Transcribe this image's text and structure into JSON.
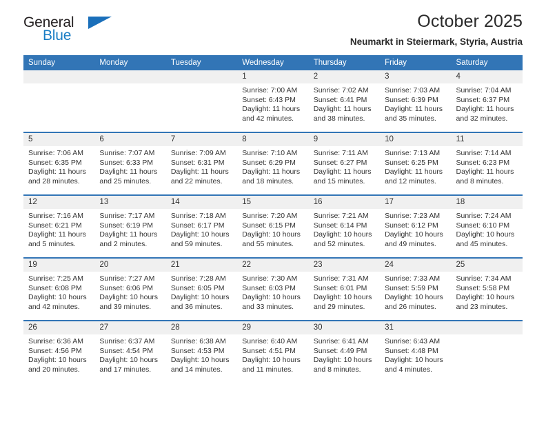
{
  "brand": {
    "name_top": "General",
    "name_bottom": "Blue",
    "triangle_color": "#1a6fba",
    "blue_text_color": "#1a7dc4"
  },
  "header": {
    "title": "October 2025",
    "subtitle": "Neumarkt in Steiermark, Styria, Austria"
  },
  "theme": {
    "header_bg": "#3275b6",
    "daynum_bg": "#f0f0f0",
    "text": "#333333"
  },
  "weekday_headers": [
    "Sunday",
    "Monday",
    "Tuesday",
    "Wednesday",
    "Thursday",
    "Friday",
    "Saturday"
  ],
  "weeks": [
    [
      {
        "day": "",
        "sunrise": "",
        "sunset": "",
        "daylight_line1": "",
        "daylight_line2": ""
      },
      {
        "day": "",
        "sunrise": "",
        "sunset": "",
        "daylight_line1": "",
        "daylight_line2": ""
      },
      {
        "day": "",
        "sunrise": "",
        "sunset": "",
        "daylight_line1": "",
        "daylight_line2": ""
      },
      {
        "day": "1",
        "sunrise": "Sunrise: 7:00 AM",
        "sunset": "Sunset: 6:43 PM",
        "daylight_line1": "Daylight: 11 hours",
        "daylight_line2": "and 42 minutes."
      },
      {
        "day": "2",
        "sunrise": "Sunrise: 7:02 AM",
        "sunset": "Sunset: 6:41 PM",
        "daylight_line1": "Daylight: 11 hours",
        "daylight_line2": "and 38 minutes."
      },
      {
        "day": "3",
        "sunrise": "Sunrise: 7:03 AM",
        "sunset": "Sunset: 6:39 PM",
        "daylight_line1": "Daylight: 11 hours",
        "daylight_line2": "and 35 minutes."
      },
      {
        "day": "4",
        "sunrise": "Sunrise: 7:04 AM",
        "sunset": "Sunset: 6:37 PM",
        "daylight_line1": "Daylight: 11 hours",
        "daylight_line2": "and 32 minutes."
      }
    ],
    [
      {
        "day": "5",
        "sunrise": "Sunrise: 7:06 AM",
        "sunset": "Sunset: 6:35 PM",
        "daylight_line1": "Daylight: 11 hours",
        "daylight_line2": "and 28 minutes."
      },
      {
        "day": "6",
        "sunrise": "Sunrise: 7:07 AM",
        "sunset": "Sunset: 6:33 PM",
        "daylight_line1": "Daylight: 11 hours",
        "daylight_line2": "and 25 minutes."
      },
      {
        "day": "7",
        "sunrise": "Sunrise: 7:09 AM",
        "sunset": "Sunset: 6:31 PM",
        "daylight_line1": "Daylight: 11 hours",
        "daylight_line2": "and 22 minutes."
      },
      {
        "day": "8",
        "sunrise": "Sunrise: 7:10 AM",
        "sunset": "Sunset: 6:29 PM",
        "daylight_line1": "Daylight: 11 hours",
        "daylight_line2": "and 18 minutes."
      },
      {
        "day": "9",
        "sunrise": "Sunrise: 7:11 AM",
        "sunset": "Sunset: 6:27 PM",
        "daylight_line1": "Daylight: 11 hours",
        "daylight_line2": "and 15 minutes."
      },
      {
        "day": "10",
        "sunrise": "Sunrise: 7:13 AM",
        "sunset": "Sunset: 6:25 PM",
        "daylight_line1": "Daylight: 11 hours",
        "daylight_line2": "and 12 minutes."
      },
      {
        "day": "11",
        "sunrise": "Sunrise: 7:14 AM",
        "sunset": "Sunset: 6:23 PM",
        "daylight_line1": "Daylight: 11 hours",
        "daylight_line2": "and 8 minutes."
      }
    ],
    [
      {
        "day": "12",
        "sunrise": "Sunrise: 7:16 AM",
        "sunset": "Sunset: 6:21 PM",
        "daylight_line1": "Daylight: 11 hours",
        "daylight_line2": "and 5 minutes."
      },
      {
        "day": "13",
        "sunrise": "Sunrise: 7:17 AM",
        "sunset": "Sunset: 6:19 PM",
        "daylight_line1": "Daylight: 11 hours",
        "daylight_line2": "and 2 minutes."
      },
      {
        "day": "14",
        "sunrise": "Sunrise: 7:18 AM",
        "sunset": "Sunset: 6:17 PM",
        "daylight_line1": "Daylight: 10 hours",
        "daylight_line2": "and 59 minutes."
      },
      {
        "day": "15",
        "sunrise": "Sunrise: 7:20 AM",
        "sunset": "Sunset: 6:15 PM",
        "daylight_line1": "Daylight: 10 hours",
        "daylight_line2": "and 55 minutes."
      },
      {
        "day": "16",
        "sunrise": "Sunrise: 7:21 AM",
        "sunset": "Sunset: 6:14 PM",
        "daylight_line1": "Daylight: 10 hours",
        "daylight_line2": "and 52 minutes."
      },
      {
        "day": "17",
        "sunrise": "Sunrise: 7:23 AM",
        "sunset": "Sunset: 6:12 PM",
        "daylight_line1": "Daylight: 10 hours",
        "daylight_line2": "and 49 minutes."
      },
      {
        "day": "18",
        "sunrise": "Sunrise: 7:24 AM",
        "sunset": "Sunset: 6:10 PM",
        "daylight_line1": "Daylight: 10 hours",
        "daylight_line2": "and 45 minutes."
      }
    ],
    [
      {
        "day": "19",
        "sunrise": "Sunrise: 7:25 AM",
        "sunset": "Sunset: 6:08 PM",
        "daylight_line1": "Daylight: 10 hours",
        "daylight_line2": "and 42 minutes."
      },
      {
        "day": "20",
        "sunrise": "Sunrise: 7:27 AM",
        "sunset": "Sunset: 6:06 PM",
        "daylight_line1": "Daylight: 10 hours",
        "daylight_line2": "and 39 minutes."
      },
      {
        "day": "21",
        "sunrise": "Sunrise: 7:28 AM",
        "sunset": "Sunset: 6:05 PM",
        "daylight_line1": "Daylight: 10 hours",
        "daylight_line2": "and 36 minutes."
      },
      {
        "day": "22",
        "sunrise": "Sunrise: 7:30 AM",
        "sunset": "Sunset: 6:03 PM",
        "daylight_line1": "Daylight: 10 hours",
        "daylight_line2": "and 33 minutes."
      },
      {
        "day": "23",
        "sunrise": "Sunrise: 7:31 AM",
        "sunset": "Sunset: 6:01 PM",
        "daylight_line1": "Daylight: 10 hours",
        "daylight_line2": "and 29 minutes."
      },
      {
        "day": "24",
        "sunrise": "Sunrise: 7:33 AM",
        "sunset": "Sunset: 5:59 PM",
        "daylight_line1": "Daylight: 10 hours",
        "daylight_line2": "and 26 minutes."
      },
      {
        "day": "25",
        "sunrise": "Sunrise: 7:34 AM",
        "sunset": "Sunset: 5:58 PM",
        "daylight_line1": "Daylight: 10 hours",
        "daylight_line2": "and 23 minutes."
      }
    ],
    [
      {
        "day": "26",
        "sunrise": "Sunrise: 6:36 AM",
        "sunset": "Sunset: 4:56 PM",
        "daylight_line1": "Daylight: 10 hours",
        "daylight_line2": "and 20 minutes."
      },
      {
        "day": "27",
        "sunrise": "Sunrise: 6:37 AM",
        "sunset": "Sunset: 4:54 PM",
        "daylight_line1": "Daylight: 10 hours",
        "daylight_line2": "and 17 minutes."
      },
      {
        "day": "28",
        "sunrise": "Sunrise: 6:38 AM",
        "sunset": "Sunset: 4:53 PM",
        "daylight_line1": "Daylight: 10 hours",
        "daylight_line2": "and 14 minutes."
      },
      {
        "day": "29",
        "sunrise": "Sunrise: 6:40 AM",
        "sunset": "Sunset: 4:51 PM",
        "daylight_line1": "Daylight: 10 hours",
        "daylight_line2": "and 11 minutes."
      },
      {
        "day": "30",
        "sunrise": "Sunrise: 6:41 AM",
        "sunset": "Sunset: 4:49 PM",
        "daylight_line1": "Daylight: 10 hours",
        "daylight_line2": "and 8 minutes."
      },
      {
        "day": "31",
        "sunrise": "Sunrise: 6:43 AM",
        "sunset": "Sunset: 4:48 PM",
        "daylight_line1": "Daylight: 10 hours",
        "daylight_line2": "and 4 minutes."
      },
      {
        "day": "",
        "sunrise": "",
        "sunset": "",
        "daylight_line1": "",
        "daylight_line2": ""
      }
    ]
  ]
}
